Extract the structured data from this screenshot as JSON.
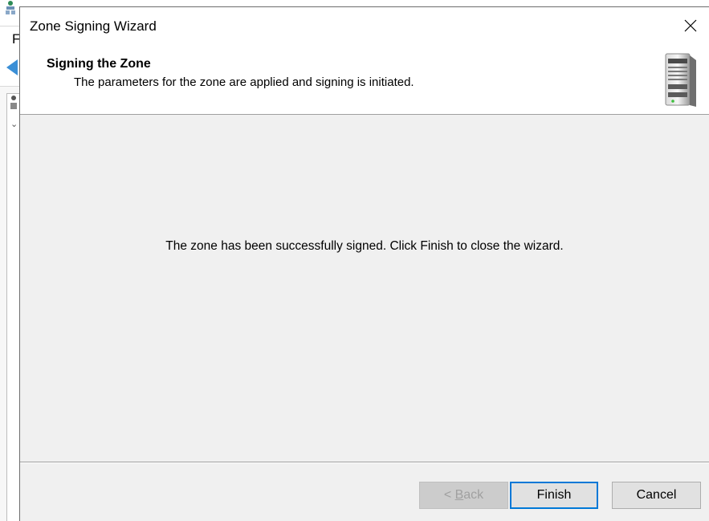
{
  "background_app": {
    "menu_letter": "F"
  },
  "dialog": {
    "title": "Zone Signing Wizard",
    "header": {
      "title": "Signing the Zone",
      "subtitle": "The parameters for the zone are applied and signing is initiated."
    },
    "message": "The zone has been successfully signed. Click Finish to close the wizard.",
    "buttons": {
      "back_prefix": "< ",
      "back_accel": "B",
      "back_rest": "ack",
      "finish": "Finish",
      "cancel": "Cancel"
    }
  },
  "colors": {
    "focus_border": "#0078d7",
    "dialog_bg": "#f0f0f0",
    "header_bg": "#ffffff"
  },
  "icons": {
    "close": "close-icon",
    "server": "server-icon",
    "back_arrow": "back-arrow-icon",
    "app": "dns-app-icon"
  }
}
